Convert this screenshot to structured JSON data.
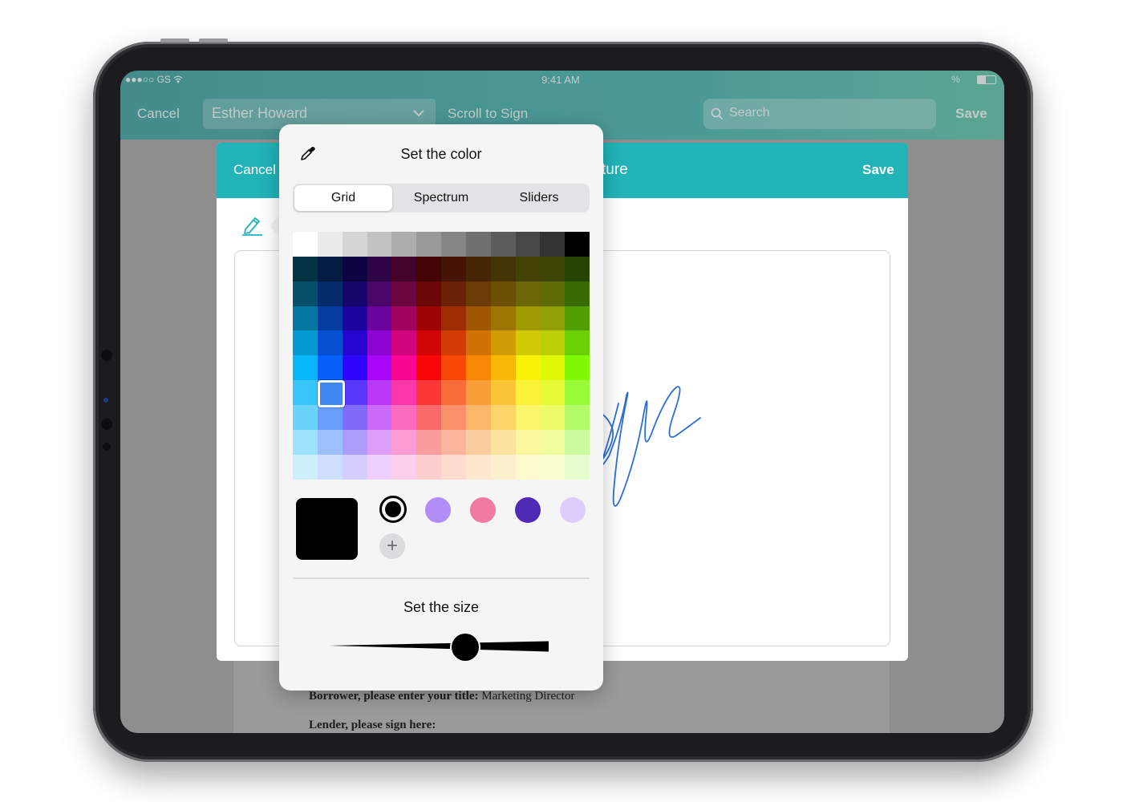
{
  "status_bar": {
    "carrier": "●●●○○ GS",
    "time": "9:41 AM",
    "battery": "%"
  },
  "background_nav": {
    "cancel_label": "Cancel",
    "signer_name": "Esther Howard",
    "scroll_label": "Scroll to Sign",
    "search_placeholder": "Search",
    "save_label": "Save"
  },
  "signature_modal": {
    "cancel_label": "Cancel",
    "title_visible": "ture",
    "save_label": "Save",
    "accent_color": "#21b3b8",
    "ink_color": "#2d6fd1"
  },
  "document": {
    "line1_label": "Borrower, please enter your title:",
    "line1_value": "Marketing Director",
    "line2_label": "Lender, please sign here:"
  },
  "color_picker": {
    "title": "Set the color",
    "eyedropper_icon": "eyedropper-icon",
    "tabs": [
      {
        "label": "Grid",
        "active": true
      },
      {
        "label": "Spectrum",
        "active": false
      },
      {
        "label": "Sliders",
        "active": false
      }
    ],
    "grid_selected": {
      "row": 6,
      "col": 1,
      "color": "#3e86f2"
    },
    "current_color": "#000000",
    "swatches": [
      {
        "color": "#000000",
        "selected": true
      },
      {
        "color": "#b38df7",
        "selected": false
      },
      {
        "color": "#f27aa1",
        "selected": false
      },
      {
        "color": "#4e2bb7",
        "selected": false
      },
      {
        "color": "#dccdfd",
        "selected": false
      }
    ],
    "add_swatch_label": "+",
    "size_title": "Set the size",
    "size_value": 0.62
  }
}
